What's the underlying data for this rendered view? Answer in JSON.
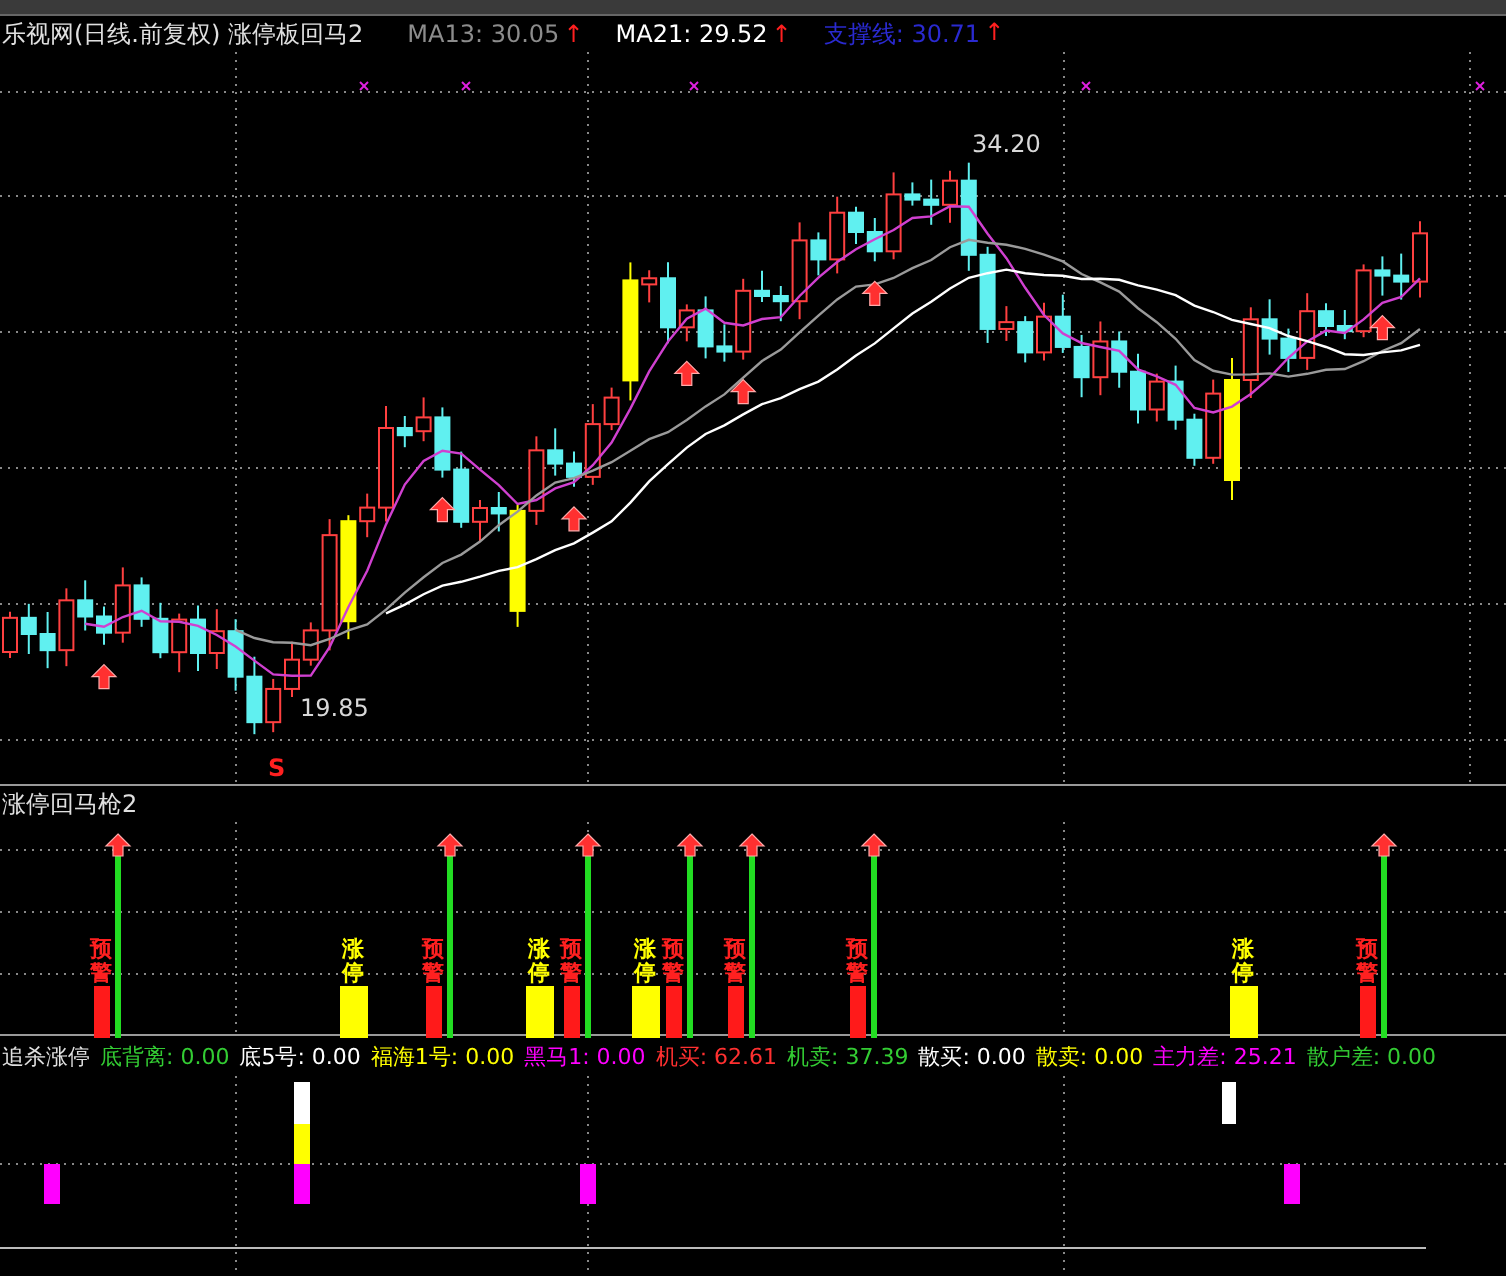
{
  "price_panel": {
    "title": "乐视网(日线.前复权) 涨停板回马2",
    "indicators": [
      {
        "label": "MA13: 30.05",
        "trend": "↑",
        "color": "#8c8c8c"
      },
      {
        "label": "MA21: 29.52",
        "trend": "↑",
        "color": "#ffffff"
      },
      {
        "label": "支撑线: 30.71",
        "trend": "↑",
        "color": "#2a2ad0"
      }
    ],
    "price_labels": [
      {
        "kind": "high",
        "text": "34.20"
      },
      {
        "kind": "low",
        "text": "19.85"
      },
      {
        "kind": "signal",
        "text": "S"
      }
    ]
  },
  "signal_panel": {
    "title": "涨停回马枪2",
    "signals": [
      {
        "kind": "warning",
        "label": "预警"
      },
      {
        "kind": "limit_up",
        "label": "涨停"
      },
      {
        "kind": "warning",
        "label": "预警"
      },
      {
        "kind": "limit_up",
        "label": "涨停"
      },
      {
        "kind": "warning",
        "label": "预警"
      },
      {
        "kind": "limit_up",
        "label": "涨停"
      },
      {
        "kind": "warning",
        "label": "预警"
      },
      {
        "kind": "warning",
        "label": "预警"
      },
      {
        "kind": "warning",
        "label": "预警"
      },
      {
        "kind": "limit_up",
        "label": "涨停"
      },
      {
        "kind": "warning",
        "label": "预警"
      }
    ]
  },
  "capital_panel": {
    "title": "追杀涨停",
    "readings": [
      {
        "label": "底背离: 0.00",
        "color": "#33cc33"
      },
      {
        "label": "底5号: 0.00",
        "color": "#ffffff"
      },
      {
        "label": "福海1号: 0.00",
        "color": "#ffff00"
      },
      {
        "label": "黑马1: 0.00",
        "color": "#ff00ff"
      },
      {
        "label": "机买: 62.61",
        "color": "#ff3030"
      },
      {
        "label": "机卖: 37.39",
        "color": "#33cc33"
      },
      {
        "label": "散买: 0.00",
        "color": "#ffffff"
      },
      {
        "label": "散卖: 0.00",
        "color": "#ffff00"
      },
      {
        "label": "主力差: 25.21",
        "color": "#ff00ff"
      },
      {
        "label": "散户差: 0.00",
        "color": "#33cc33"
      }
    ]
  }
}
